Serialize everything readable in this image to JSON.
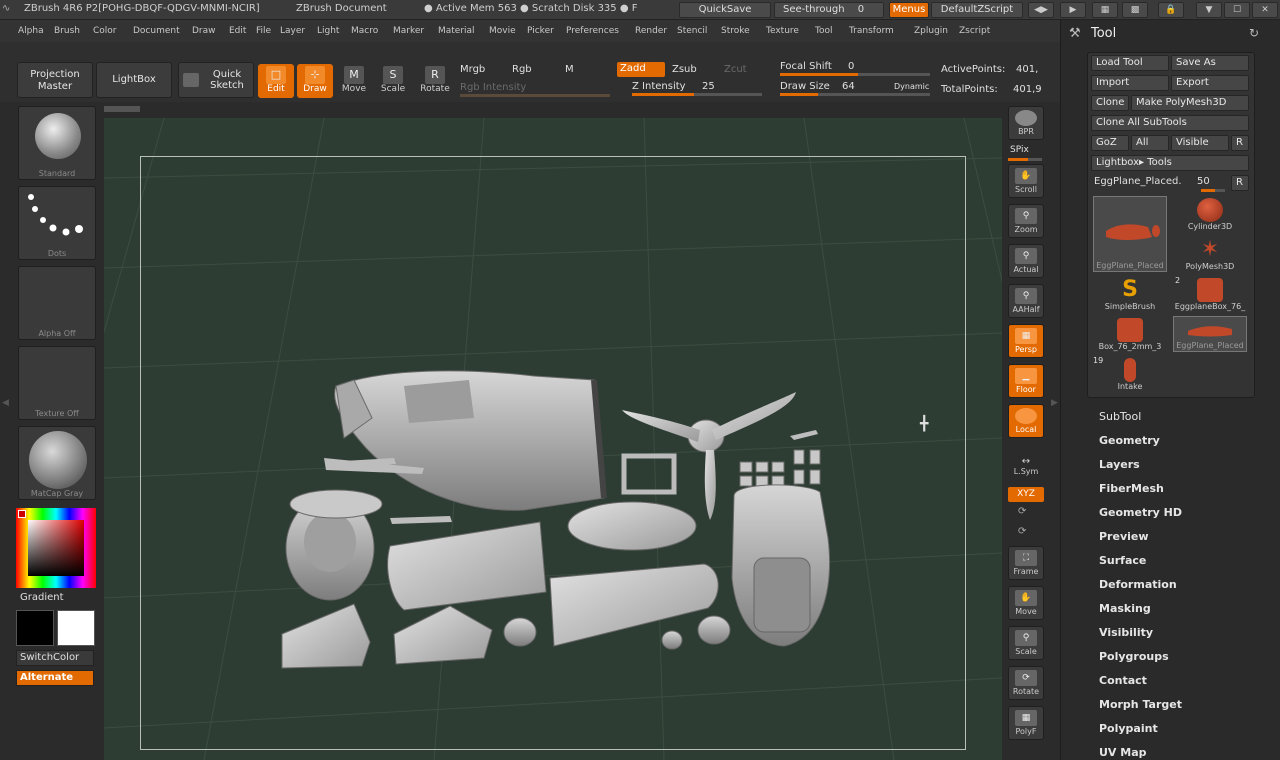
{
  "titlebar": {
    "app": "ZBrush 4R6 P2[POHG-DBQF-QDGV-MNMI-NCIR]",
    "doc": "ZBrush Document",
    "mem": "● Active Mem 563 ● Scratch Disk 335 ● F",
    "quicksave": "QuickSave",
    "seethrough": "See-through",
    "seethrough_value": "0",
    "menus": "Menus",
    "script": "DefaultZScript"
  },
  "menus": [
    "Alpha",
    "Brush",
    "Color",
    "Document",
    "Draw",
    "Edit",
    "File",
    "Layer",
    "Light",
    "Macro",
    "Marker",
    "Material",
    "Movie",
    "Picker",
    "Preferences",
    "Render",
    "Stencil",
    "Stroke",
    "Texture",
    "Tool",
    "Transform",
    "Zplugin",
    "Zscript"
  ],
  "toolbar": {
    "projection_master": "Projection Master",
    "lightbox": "LightBox",
    "quick_sketch": "Quick Sketch",
    "edit": "Edit",
    "draw": "Draw",
    "move": "Move",
    "scale": "Scale",
    "rotate": "Rotate",
    "mrgb": "Mrgb",
    "rgb": "Rgb",
    "m": "M",
    "rgb_intensity": "Rgb Intensity",
    "zadd": "Zadd",
    "zsub": "Zsub",
    "zcut": "Zcut",
    "z_intensity_label": "Z Intensity",
    "z_intensity": "25",
    "focal_shift_label": "Focal Shift",
    "focal_shift": "0",
    "draw_size_label": "Draw Size",
    "draw_size": "64",
    "dynamic": "Dynamic",
    "active_points_label": "ActivePoints:",
    "active_points": "401,",
    "total_points_label": "TotalPoints:",
    "total_points": "401,9"
  },
  "leftshelf": {
    "brush": "Standard",
    "stroke": "Dots",
    "alpha": "Alpha Off",
    "texture": "Texture Off",
    "material": "MatCap Gray",
    "gradient": "Gradient",
    "switchcolor": "SwitchColor",
    "alternate": "Alternate"
  },
  "rightshelf": {
    "bpr": "BPR",
    "spix": "SPix",
    "scroll": "Scroll",
    "zoom": "Zoom",
    "actual": "Actual",
    "aahalf": "AAHalf",
    "persp": "Persp",
    "floor": "Floor",
    "local": "Local",
    "lsym": "L.Sym",
    "xyz": "XYZ",
    "frame": "Frame",
    "move": "Move",
    "scale": "Scale",
    "rotate": "Rotate",
    "polyf": "PolyF"
  },
  "toolpanel": {
    "title": "Tool",
    "load_tool": "Load Tool",
    "save_as": "Save As",
    "import": "Import",
    "export": "Export",
    "clone": "Clone",
    "make_polymesh": "Make PolyMesh3D",
    "clone_all": "Clone All SubTools",
    "goz": "GoZ",
    "all": "All",
    "visible": "Visible",
    "r": "R",
    "lightbox_tools": "Lightbox▸ Tools",
    "current_tool": "EggPlane_Placed.",
    "current_value": "50",
    "thumbs": [
      {
        "name": "EggPlane_Placed",
        "badge": ""
      },
      {
        "name": "Cylinder3D",
        "badge": ""
      },
      {
        "name": "PolyMesh3D",
        "badge": ""
      },
      {
        "name": "SimpleBrush",
        "badge": "2"
      },
      {
        "name": "EggplaneBox_76_",
        "badge": ""
      },
      {
        "name": "Box_76_2mm_3",
        "badge": "19"
      },
      {
        "name": "EggPlane_Placed",
        "badge": ""
      },
      {
        "name": "Intake",
        "badge": ""
      }
    ],
    "sections": [
      "SubTool",
      "Geometry",
      "Layers",
      "FiberMesh",
      "Geometry HD",
      "Preview",
      "Surface",
      "Deformation",
      "Masking",
      "Visibility",
      "Polygroups",
      "Contact",
      "Morph Target",
      "Polypaint",
      "UV Map"
    ]
  },
  "colors": {
    "accent": "#e36a00",
    "canvas": "#2e3d33",
    "model": "#b9b9b9"
  }
}
